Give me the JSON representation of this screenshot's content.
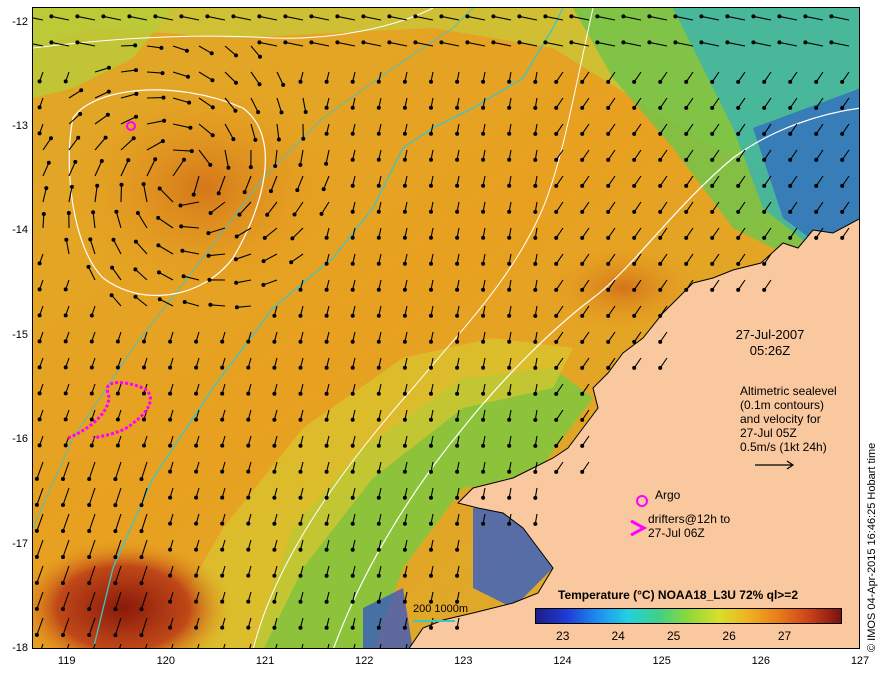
{
  "map": {
    "y_ticks": [
      "-12",
      "-13",
      "-14",
      "-15",
      "-16",
      "-17",
      "-18"
    ],
    "x_ticks": [
      "119",
      "120",
      "121",
      "122",
      "123",
      "124",
      "125",
      "126",
      "127"
    ],
    "lat_range": [
      -18,
      -11.85
    ],
    "lon_range": [
      118.65,
      127
    ],
    "date": "27-Jul-2007",
    "time": "05:26Z",
    "velocity_lines": [
      "Altimetric sealevel",
      "(0.1m contours)",
      "and velocity for",
      "27-Jul 05Z",
      "0.5m/s (1kt 24h)"
    ],
    "argo_label": "Argo",
    "drifters_lines": [
      "drifters@12h to",
      "27-Jul 06Z"
    ],
    "scale_label": "200  1000m",
    "credit": "© IMOS 04-Apr-2015 16:46:25 Hobart time",
    "colorbar": {
      "title": "Temperature (°C) NOAA18_L3U 72% ql>=2",
      "ticks": [
        "23",
        "24",
        "25",
        "26",
        "27"
      ],
      "range": [
        22.5,
        28
      ]
    },
    "colors": {
      "land": "#f9c89e",
      "ocean_warm": "#e8a020",
      "ocean_hot": "#b04010",
      "ocean_mid": "#d8c030",
      "ocean_cool": "#8acc40",
      "ocean_cold": "#2a4ed0",
      "bathymetry_200": "#3cc6c8",
      "bathymetry_1000": "#ffffff",
      "argo": "#ff00ff",
      "drifter": "#ff00ff",
      "vector": "#000000"
    }
  }
}
